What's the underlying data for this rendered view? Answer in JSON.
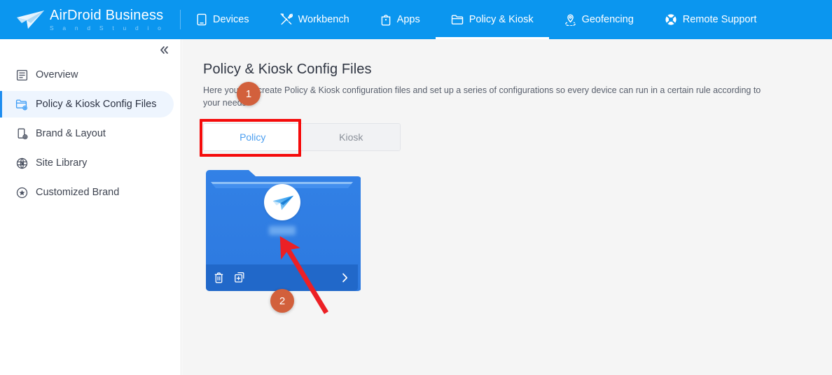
{
  "brand": {
    "title": "AirDroid Business",
    "subtitle": "S a n d    S t u d i o",
    "logo_icon": "airdroid-paper-plane-logo"
  },
  "topnav": {
    "items": [
      {
        "label": "Devices",
        "icon": "tablet-icon",
        "active": false
      },
      {
        "label": "Workbench",
        "icon": "tools-icon",
        "active": false
      },
      {
        "label": "Apps",
        "icon": "app-bag-icon",
        "active": false
      },
      {
        "label": "Policy & Kiosk",
        "icon": "folder-icon",
        "active": true
      },
      {
        "label": "Geofencing",
        "icon": "location-pin-icon",
        "active": false
      },
      {
        "label": "Remote Support",
        "icon": "lifebuoy-icon",
        "active": false
      }
    ]
  },
  "sidebar": {
    "collapse_icon": "double-chevron-left-icon",
    "items": [
      {
        "label": "Overview",
        "icon": "list-document-icon",
        "active": false
      },
      {
        "label": "Policy & Kiosk Config Files",
        "icon": "folder-settings-icon",
        "active": true
      },
      {
        "label": "Brand & Layout",
        "icon": "phone-settings-icon",
        "active": false
      },
      {
        "label": "Site Library",
        "icon": "globe-circle-icon",
        "active": false
      },
      {
        "label": "Customized Brand",
        "icon": "star-circle-icon",
        "active": false
      }
    ]
  },
  "main": {
    "title": "Policy & Kiosk Config Files",
    "description": "Here you can create Policy & Kiosk configuration files and set up a series of configurations so every device can run in a certain rule according to your needs",
    "tabs": [
      {
        "label": "Policy",
        "active": true
      },
      {
        "label": "Kiosk",
        "active": false
      }
    ],
    "cards": [
      {
        "logo_icon": "airdroid-paper-plane-logo",
        "name_redacted": true,
        "actions": [
          {
            "icon": "trash-icon",
            "name": "delete"
          },
          {
            "icon": "copy-plus-icon",
            "name": "duplicate"
          },
          {
            "icon": "chevron-right-icon",
            "name": "open"
          }
        ]
      }
    ]
  },
  "annotations": {
    "badges": [
      {
        "number": "1"
      },
      {
        "number": "2"
      }
    ],
    "highlight_target": "Policy",
    "arrow_target": "policy-config-card"
  },
  "colors": {
    "brand_blue": "#0b96ef",
    "accent_blue": "#1e8df0",
    "card_blue": "#2c7ae0",
    "badge_orange": "#d2603c",
    "highlight_red": "#f50b0b",
    "main_bg": "#f5f5f5"
  }
}
